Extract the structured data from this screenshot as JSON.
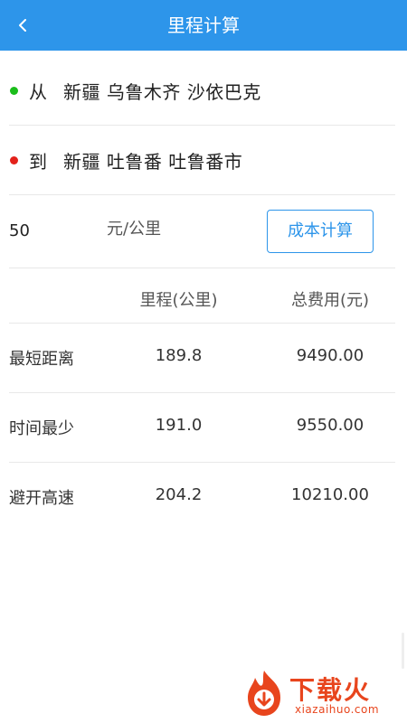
{
  "header": {
    "title": "里程计算",
    "back_icon": "chevron-left-icon"
  },
  "route": {
    "from": {
      "label": "从",
      "location": "新疆 乌鲁木齐 沙依巴克",
      "dot_color": "#1bbd1b"
    },
    "to": {
      "label": "到",
      "location": "新疆 吐鲁番 吐鲁番市",
      "dot_color": "#e3211a"
    }
  },
  "cost": {
    "price_value": "50",
    "unit": "元/公里",
    "calc_button": "成本计算"
  },
  "table": {
    "headers": {
      "route": "",
      "distance": "里程(公里)",
      "cost": "总费用(元)"
    },
    "rows": [
      {
        "route": "最短距离",
        "distance": "189.8",
        "cost": "9490.00"
      },
      {
        "route": "时间最少",
        "distance": "191.0",
        "cost": "9550.00"
      },
      {
        "route": "避开高速",
        "distance": "204.2",
        "cost": "10210.00"
      }
    ]
  },
  "watermark": {
    "title": "下载火",
    "domain": "xiazaihuo.com"
  },
  "colors": {
    "accent": "#2d95ea",
    "brand_watermark": "#e8451d"
  }
}
